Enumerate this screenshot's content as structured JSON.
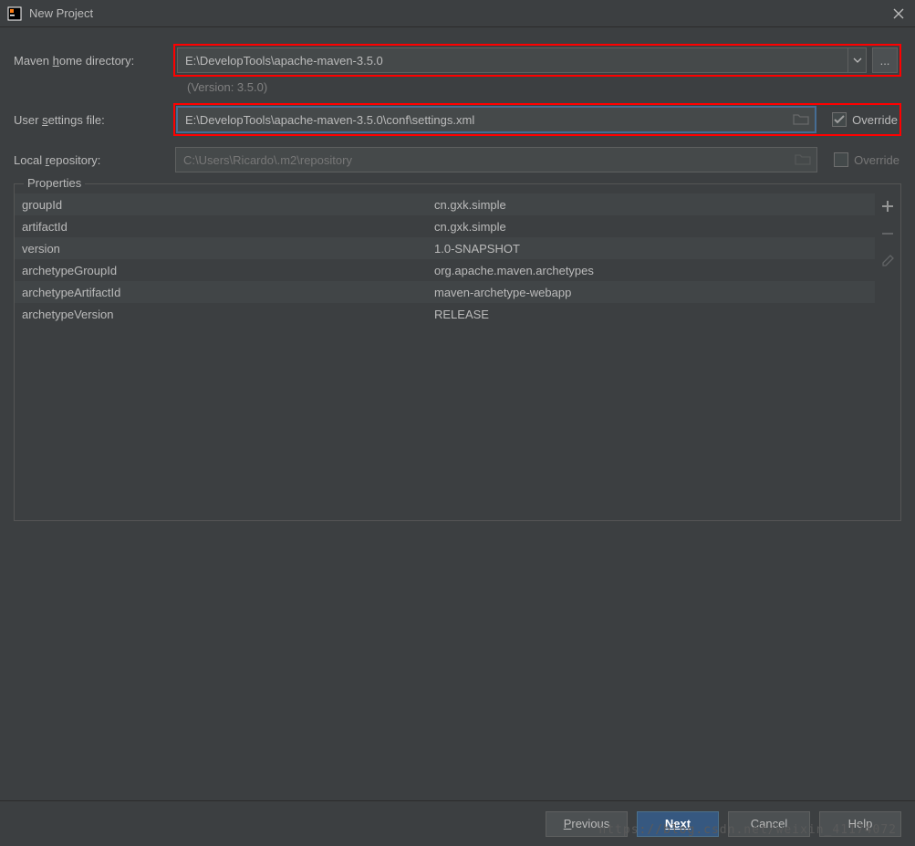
{
  "window": {
    "title": "New Project"
  },
  "form": {
    "maven_home_label": "Maven home directory:",
    "maven_home_value": "E:\\DevelopTools\\apache-maven-3.5.0",
    "version_text": "(Version: 3.5.0)",
    "user_settings_label": "User settings file:",
    "user_settings_value": "E:\\DevelopTools\\apache-maven-3.5.0\\conf\\settings.xml",
    "local_repo_label": "Local repository:",
    "local_repo_value": "C:\\Users\\Ricardo\\.m2\\repository",
    "override_label": "Override",
    "browse_label": "..."
  },
  "properties": {
    "legend": "Properties",
    "rows": [
      {
        "key": "groupId",
        "val": "cn.gxk.simple"
      },
      {
        "key": "artifactId",
        "val": "cn.gxk.simple"
      },
      {
        "key": "version",
        "val": "1.0-SNAPSHOT"
      },
      {
        "key": "archetypeGroupId",
        "val": "org.apache.maven.archetypes"
      },
      {
        "key": "archetypeArtifactId",
        "val": "maven-archetype-webapp"
      },
      {
        "key": "archetypeVersion",
        "val": "RELEASE"
      }
    ]
  },
  "footer": {
    "previous": "Previous",
    "next": "Next",
    "cancel": "Cancel",
    "help": "Help"
  },
  "watermark": "https://blog.csdn.net/weixin_41174072"
}
